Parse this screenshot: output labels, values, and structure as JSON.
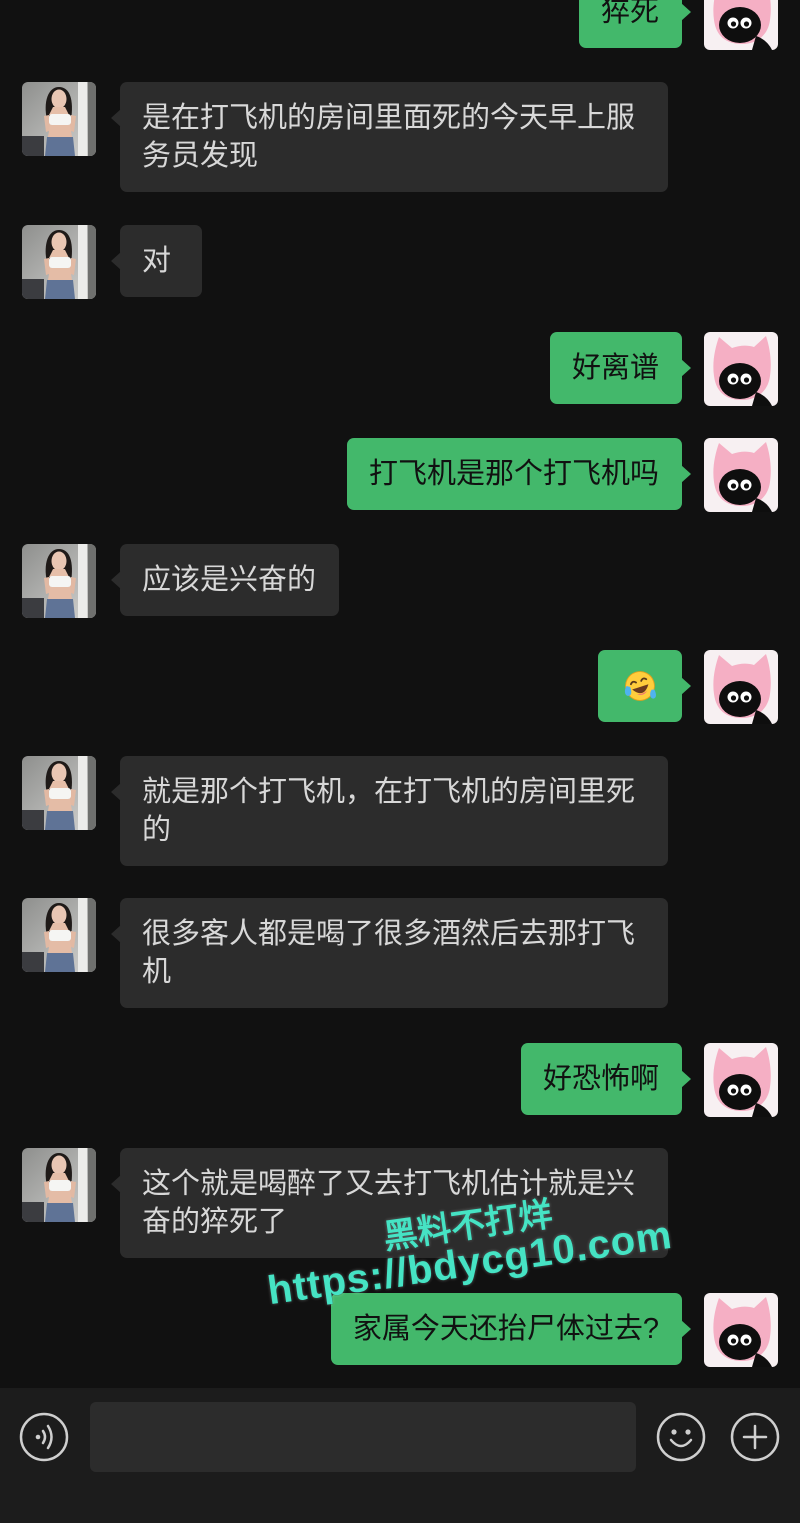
{
  "colors": {
    "background": "#111111",
    "received_bubble": "#2c2c2c",
    "received_text": "#d8d8d8",
    "sent_bubble": "#43b86b",
    "sent_text": "#111111",
    "input_bar": "#1c1c1c",
    "watermark": "#46e3c4"
  },
  "chat": {
    "contact_avatar_icon": "contact-photo-avatar",
    "my_avatar_icon": "pink-cat-avatar",
    "messages": [
      {
        "outgoing": true,
        "text": "猝死"
      },
      {
        "outgoing": false,
        "text": "是在打飞机的房间里面死的今天早上服务员发现"
      },
      {
        "outgoing": false,
        "text": "对"
      },
      {
        "outgoing": true,
        "text": "好离谱"
      },
      {
        "outgoing": true,
        "text": "打飞机是那个打飞机吗"
      },
      {
        "outgoing": false,
        "text": "应该是兴奋的"
      },
      {
        "outgoing": true,
        "emoji_icon": "tears-of-joy-emoji"
      },
      {
        "outgoing": false,
        "text": "就是那个打飞机，在打飞机的房间里死的"
      },
      {
        "outgoing": false,
        "text": "很多客人都是喝了很多酒然后去那打飞机"
      },
      {
        "outgoing": true,
        "text": "好恐怖啊"
      },
      {
        "outgoing": false,
        "text": "这个就是喝醉了又去打飞机估计就是兴奋的猝死了"
      },
      {
        "outgoing": true,
        "text": "家属今天还抬尸体过去?"
      }
    ]
  },
  "watermark": {
    "title": "黑料不打烊",
    "url": "https://bdycg10.com"
  },
  "input_bar": {
    "value": "",
    "voice_icon": "voice-icon",
    "emoji_icon": "smiley-icon",
    "more_icon": "plus-icon"
  }
}
